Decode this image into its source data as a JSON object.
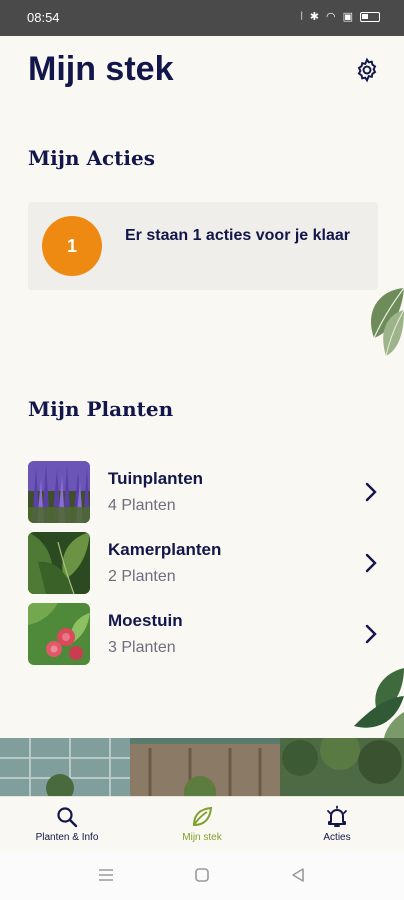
{
  "status_bar": {
    "time": "08:54",
    "icons": [
      "vibrate-icon",
      "bluetooth-icon",
      "wifi-icon",
      "notification-icon",
      "battery-icon"
    ]
  },
  "header": {
    "title": "Mijn stek",
    "settings_icon": "gear-icon"
  },
  "actions": {
    "title": "Mijn Acties",
    "count": "1",
    "message": "Er staan 1 acties voor je klaar"
  },
  "plants": {
    "title": "Mijn Planten",
    "groups": [
      {
        "name": "Tuinplanten",
        "count": "4 Planten",
        "image": "lavender-photo"
      },
      {
        "name": "Kamerplanten",
        "count": "2 Planten",
        "image": "houseplant-photo"
      },
      {
        "name": "Moestuin",
        "count": "3 Planten",
        "image": "raspberry-photo"
      }
    ]
  },
  "tabs": [
    {
      "label": "Planten & Info",
      "icon": "search-icon",
      "active": false
    },
    {
      "label": "Mijn stek",
      "icon": "leaf-icon",
      "active": true
    },
    {
      "label": "Acties",
      "icon": "bell-icon",
      "active": false
    }
  ],
  "colors": {
    "primary": "#13164a",
    "accent_orange": "#ee8a12",
    "accent_green": "#7da02d",
    "background": "#faf8f2"
  }
}
